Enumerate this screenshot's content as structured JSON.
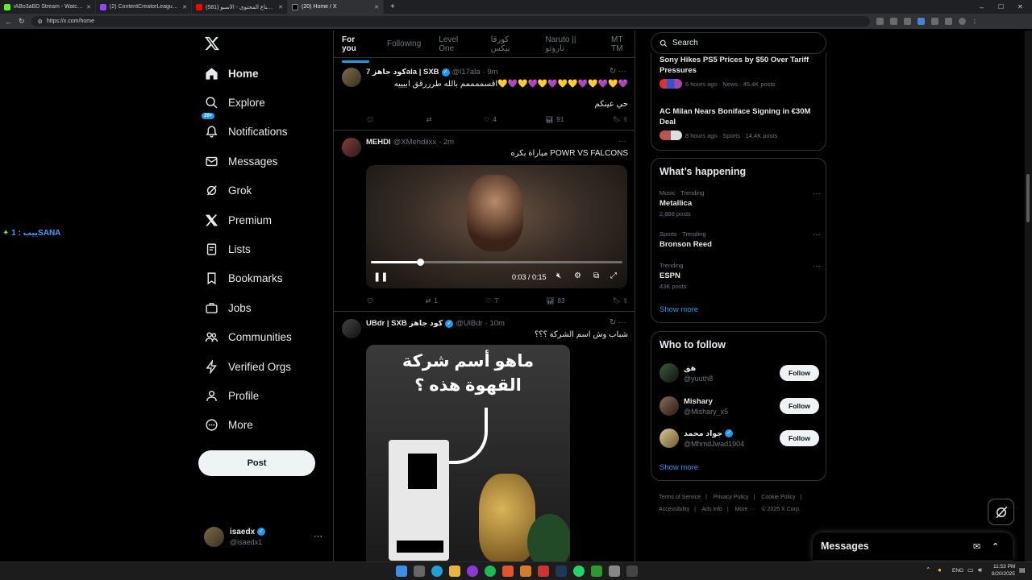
{
  "browser": {
    "tabs": [
      {
        "title": "iABo3aBD Stream - Watch Live o",
        "color": "#53fc18"
      },
      {
        "title": "(2) ContentCreatorLeague - Twitc",
        "color": "#9146ff"
      },
      {
        "title": "(581) دوري صناع المحتوى - الأسبو",
        "color": "#ff0000"
      },
      {
        "title": "(20) Home / X",
        "color": "#ffffff"
      }
    ],
    "url": "https://x.com/home"
  },
  "overlay_text": "ييب : 1SANA",
  "nav": {
    "items": [
      {
        "label": "Home",
        "icon": "home-icon"
      },
      {
        "label": "Explore",
        "icon": "search-icon"
      },
      {
        "label": "Notifications",
        "icon": "bell-icon"
      },
      {
        "label": "Messages",
        "icon": "envelope-icon"
      },
      {
        "label": "Grok",
        "icon": "grok-icon"
      },
      {
        "label": "Premium",
        "icon": "x-logo-icon"
      },
      {
        "label": "Lists",
        "icon": "list-icon"
      },
      {
        "label": "Bookmarks",
        "icon": "bookmark-icon"
      },
      {
        "label": "Jobs",
        "icon": "briefcase-icon"
      },
      {
        "label": "Communities",
        "icon": "people-icon"
      },
      {
        "label": "Verified Orgs",
        "icon": "lightning-icon"
      },
      {
        "label": "Profile",
        "icon": "person-icon"
      },
      {
        "label": "More",
        "icon": "more-circle-icon"
      }
    ],
    "notifications_badge": "20+",
    "post_label": "Post"
  },
  "account": {
    "name": "isaedx",
    "handle": "@isaedx1",
    "more": "···"
  },
  "timeline": {
    "tabs": [
      "For you",
      "Following",
      "Level One",
      "كورقا بيكس",
      "Naruto || ناروتو",
      "MT TM"
    ],
    "tweets": [
      {
        "name": "كود جاهز 7ala | SXB",
        "handle": "@l17ala",
        "time": "· 9m",
        "text1": "اقسممممم بالله طرررقق ابيييه💛💜💛💜💛💜💛💛💜💛💜💛💜",
        "text2": "حي عينكم",
        "replies": "",
        "retweets": "",
        "likes": "4",
        "views": "91"
      },
      {
        "name": "MEHDI",
        "handle": "@XMehdiixx",
        "time": "· 2m",
        "text1": "مباراة بكره POWR VS FALCONS",
        "video_time": "0:03 / 0:15",
        "replies": "",
        "retweets": "1",
        "likes": "7",
        "views": "83"
      },
      {
        "name": "UBdr | SXB كود جاهز",
        "handle": "@UlBdr",
        "time": "· 10m",
        "text1": "شباب وش اسم الشركة ؟؟؟",
        "image_text1": "ماهو أسم شركة",
        "image_text2": "القهوة هذه ؟"
      }
    ]
  },
  "search": {
    "placeholder": "Search"
  },
  "news": [
    {
      "title": "Sony Hikes PS5 Prices by $50 Over Tariff Pressures",
      "meta": "6 hours ago · News · 45.4K posts"
    },
    {
      "title": "AC Milan Nears Boniface Signing in €30M Deal",
      "meta": "8 hours ago · Sports · 14.4K posts"
    }
  ],
  "happening": {
    "title": "What’s happening",
    "trends": [
      {
        "context": "Music · Trending",
        "name": "Metallica",
        "posts": "2,868 posts"
      },
      {
        "context": "Sports · Trending",
        "name": "Bronson Reed",
        "posts": ""
      },
      {
        "context": "Trending",
        "name": "ESPN",
        "posts": "43K posts"
      }
    ],
    "show_more": "Show more"
  },
  "who_to_follow": {
    "title": "Who to follow",
    "users": [
      {
        "name": "هق",
        "handle": "@yuuth8",
        "button": "Follow"
      },
      {
        "name": "Mishary",
        "handle": "@Mishary_x5",
        "button": "Follow"
      },
      {
        "name": "جواد محمد",
        "handle": "@MhmdJwad1904",
        "button": "Follow"
      }
    ],
    "show_more": "Show more"
  },
  "footer": {
    "links": [
      "Terms of Service",
      "|",
      "Privacy Policy",
      "|",
      "Cookie Policy",
      "|",
      "Accessibility",
      "|",
      "Ads info",
      "|",
      "More ···",
      "© 2025 X Corp."
    ]
  },
  "messages_drawer": {
    "title": "Messages"
  },
  "taskbar": {
    "lang": "ENG",
    "time": "11:53 PM",
    "date": "8/20/2025"
  },
  "colors": {
    "accent": "#1d9bf0",
    "background": "#000000",
    "border": "#2f3336",
    "muted": "#71767b"
  }
}
